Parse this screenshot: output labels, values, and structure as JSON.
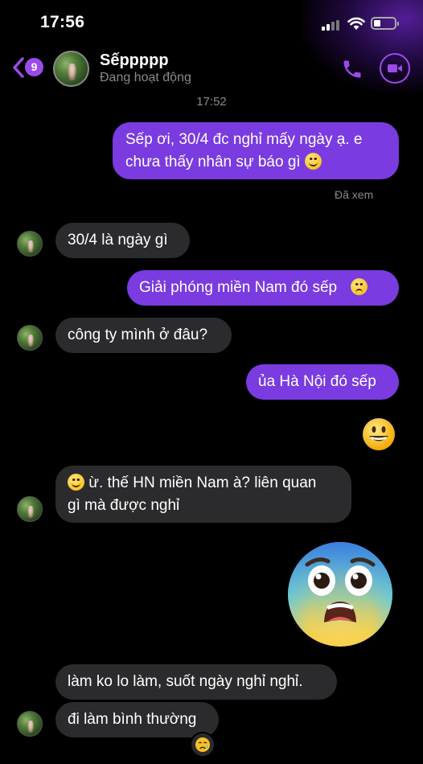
{
  "status_bar": {
    "time": "17:56"
  },
  "header": {
    "unread_count": "9",
    "contact_name": "Sếppppp",
    "contact_status": "Đang hoạt động"
  },
  "icons": {
    "back": "chevron-left-icon",
    "call": "phone-icon",
    "video": "video-camera-icon"
  },
  "colors": {
    "accent": "#9b4bea",
    "outgoing_bubble": "#7a3be0",
    "incoming_bubble": "#2b2b2d",
    "background": "#000000"
  },
  "conversation": {
    "timestamp": "17:52",
    "seen_label": "Đã xem",
    "messages": [
      {
        "from": "me",
        "text": "Sếp ơi, 30/4 đc nghỉ mấy ngày ạ. e",
        "text2": "chưa thấy nhân sự báo gì"
      },
      {
        "from": "boss",
        "text": "30/4 là ngày gì"
      },
      {
        "from": "me",
        "text": "Giải phóng miền Nam đó sếp"
      },
      {
        "from": "boss",
        "text": "công ty mình ở đâu?"
      },
      {
        "from": "me",
        "text": "ủa Hà Nội đó sếp"
      },
      {
        "from": "me",
        "type": "emoji",
        "emoji": "😀"
      },
      {
        "from": "boss",
        "text": "ừ. thế HN miền Nam à? liên quan",
        "text2": "gì mà được nghỉ"
      },
      {
        "from": "me",
        "type": "emoji",
        "emoji": "😨"
      },
      {
        "from": "boss",
        "text": "làm ko lo làm, suốt ngày nghỉ nghỉ."
      },
      {
        "from": "boss",
        "text": "đi làm bình thường",
        "reaction": "😢"
      }
    ]
  }
}
